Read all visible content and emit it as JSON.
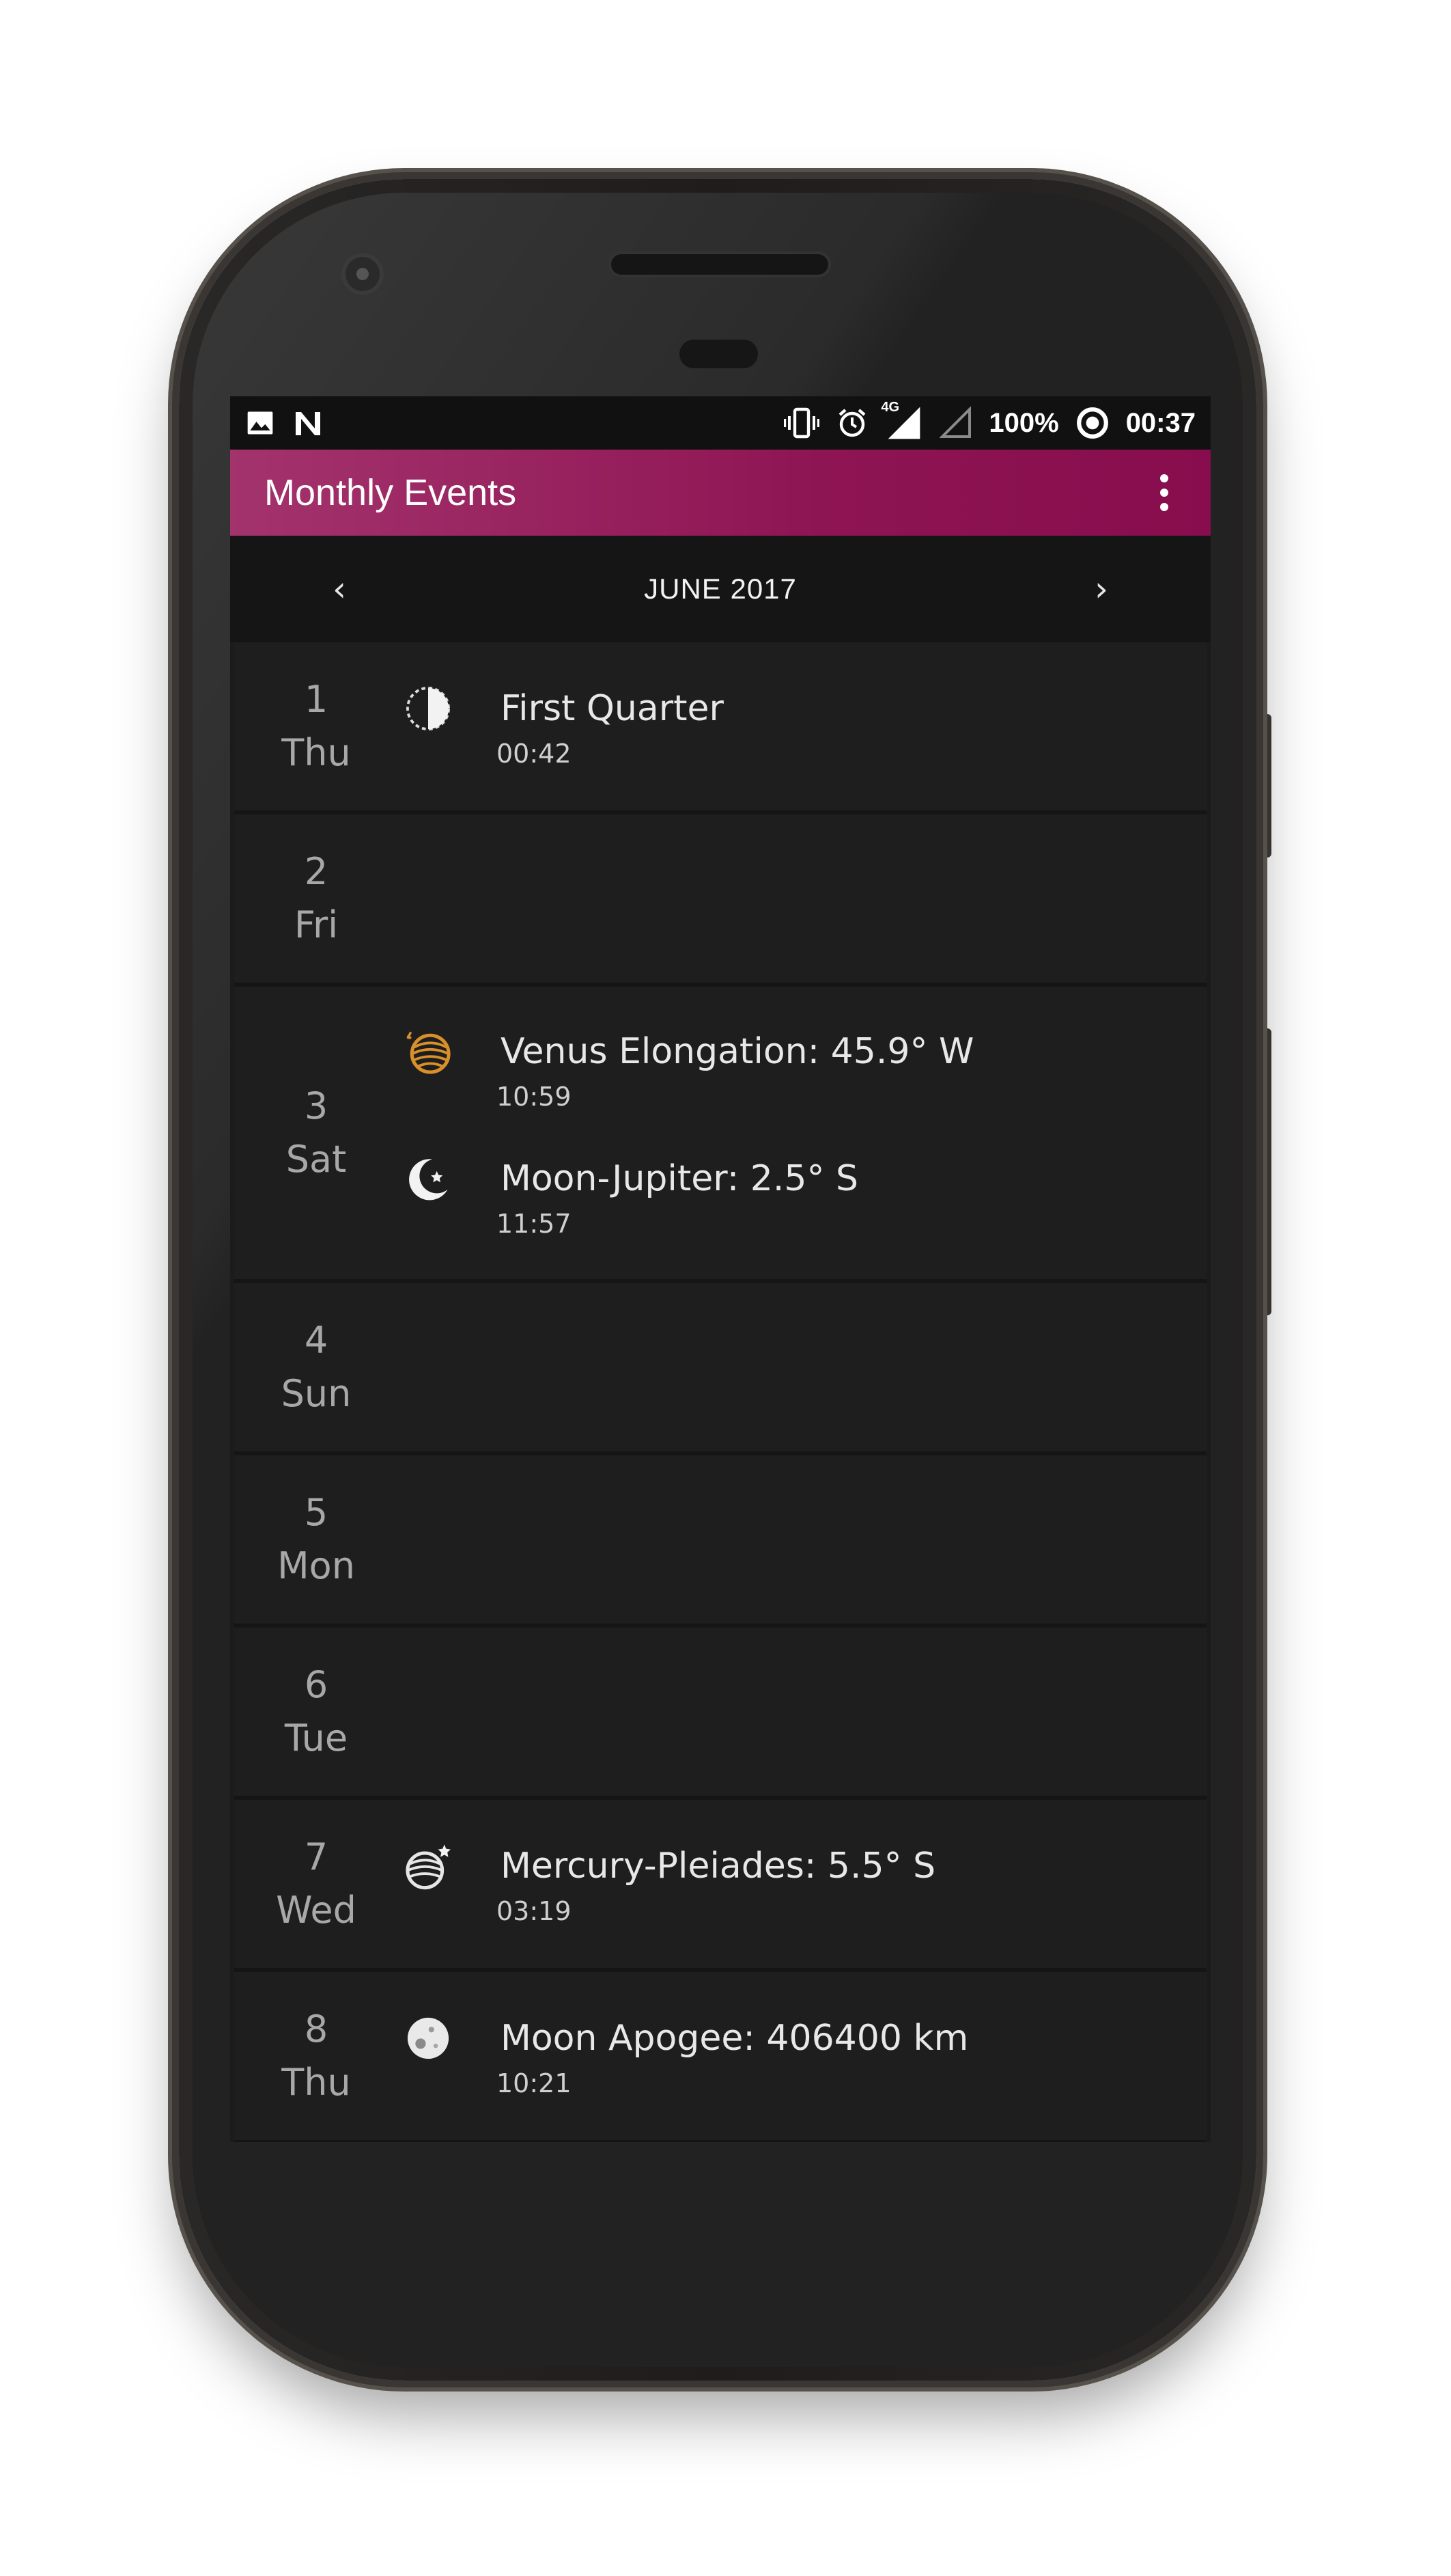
{
  "status_bar": {
    "battery": "100%",
    "time": "00:37",
    "network": "4G",
    "left_icons": [
      "image-icon",
      "n-notification-icon"
    ],
    "right_icons": [
      "vibrate-icon",
      "alarm-icon",
      "signal-icon",
      "no-signal-icon",
      "data-saver-icon"
    ]
  },
  "app_bar": {
    "title": "Monthly Events",
    "menu_icon": "more-vert-icon",
    "color": "#8e1553"
  },
  "month_nav": {
    "label": "JUNE 2017",
    "prev": "‹",
    "next": "›"
  },
  "days": [
    {
      "num": "1",
      "dow": "Thu",
      "events": [
        {
          "icon": "first-quarter-moon-icon",
          "title": "First Quarter",
          "time": "00:42"
        }
      ]
    },
    {
      "num": "2",
      "dow": "Fri",
      "events": []
    },
    {
      "num": "3",
      "dow": "Sat",
      "events": [
        {
          "icon": "venus-planet-icon",
          "title": "Venus Elongation: 45.9° W",
          "time": "10:59"
        },
        {
          "icon": "crescent-moon-star-icon",
          "title": "Moon-Jupiter: 2.5° S",
          "time": "11:57"
        }
      ]
    },
    {
      "num": "4",
      "dow": "Sun",
      "events": []
    },
    {
      "num": "5",
      "dow": "Mon",
      "events": []
    },
    {
      "num": "6",
      "dow": "Tue",
      "events": []
    },
    {
      "num": "7",
      "dow": "Wed",
      "events": [
        {
          "icon": "planet-star-icon",
          "title": "Mercury-Pleiades: 5.5° S",
          "time": "03:19"
        }
      ]
    },
    {
      "num": "8",
      "dow": "Thu",
      "events": [
        {
          "icon": "full-moon-icon",
          "title": "Moon Apogee: 406400 km",
          "time": "10:21"
        }
      ]
    }
  ]
}
